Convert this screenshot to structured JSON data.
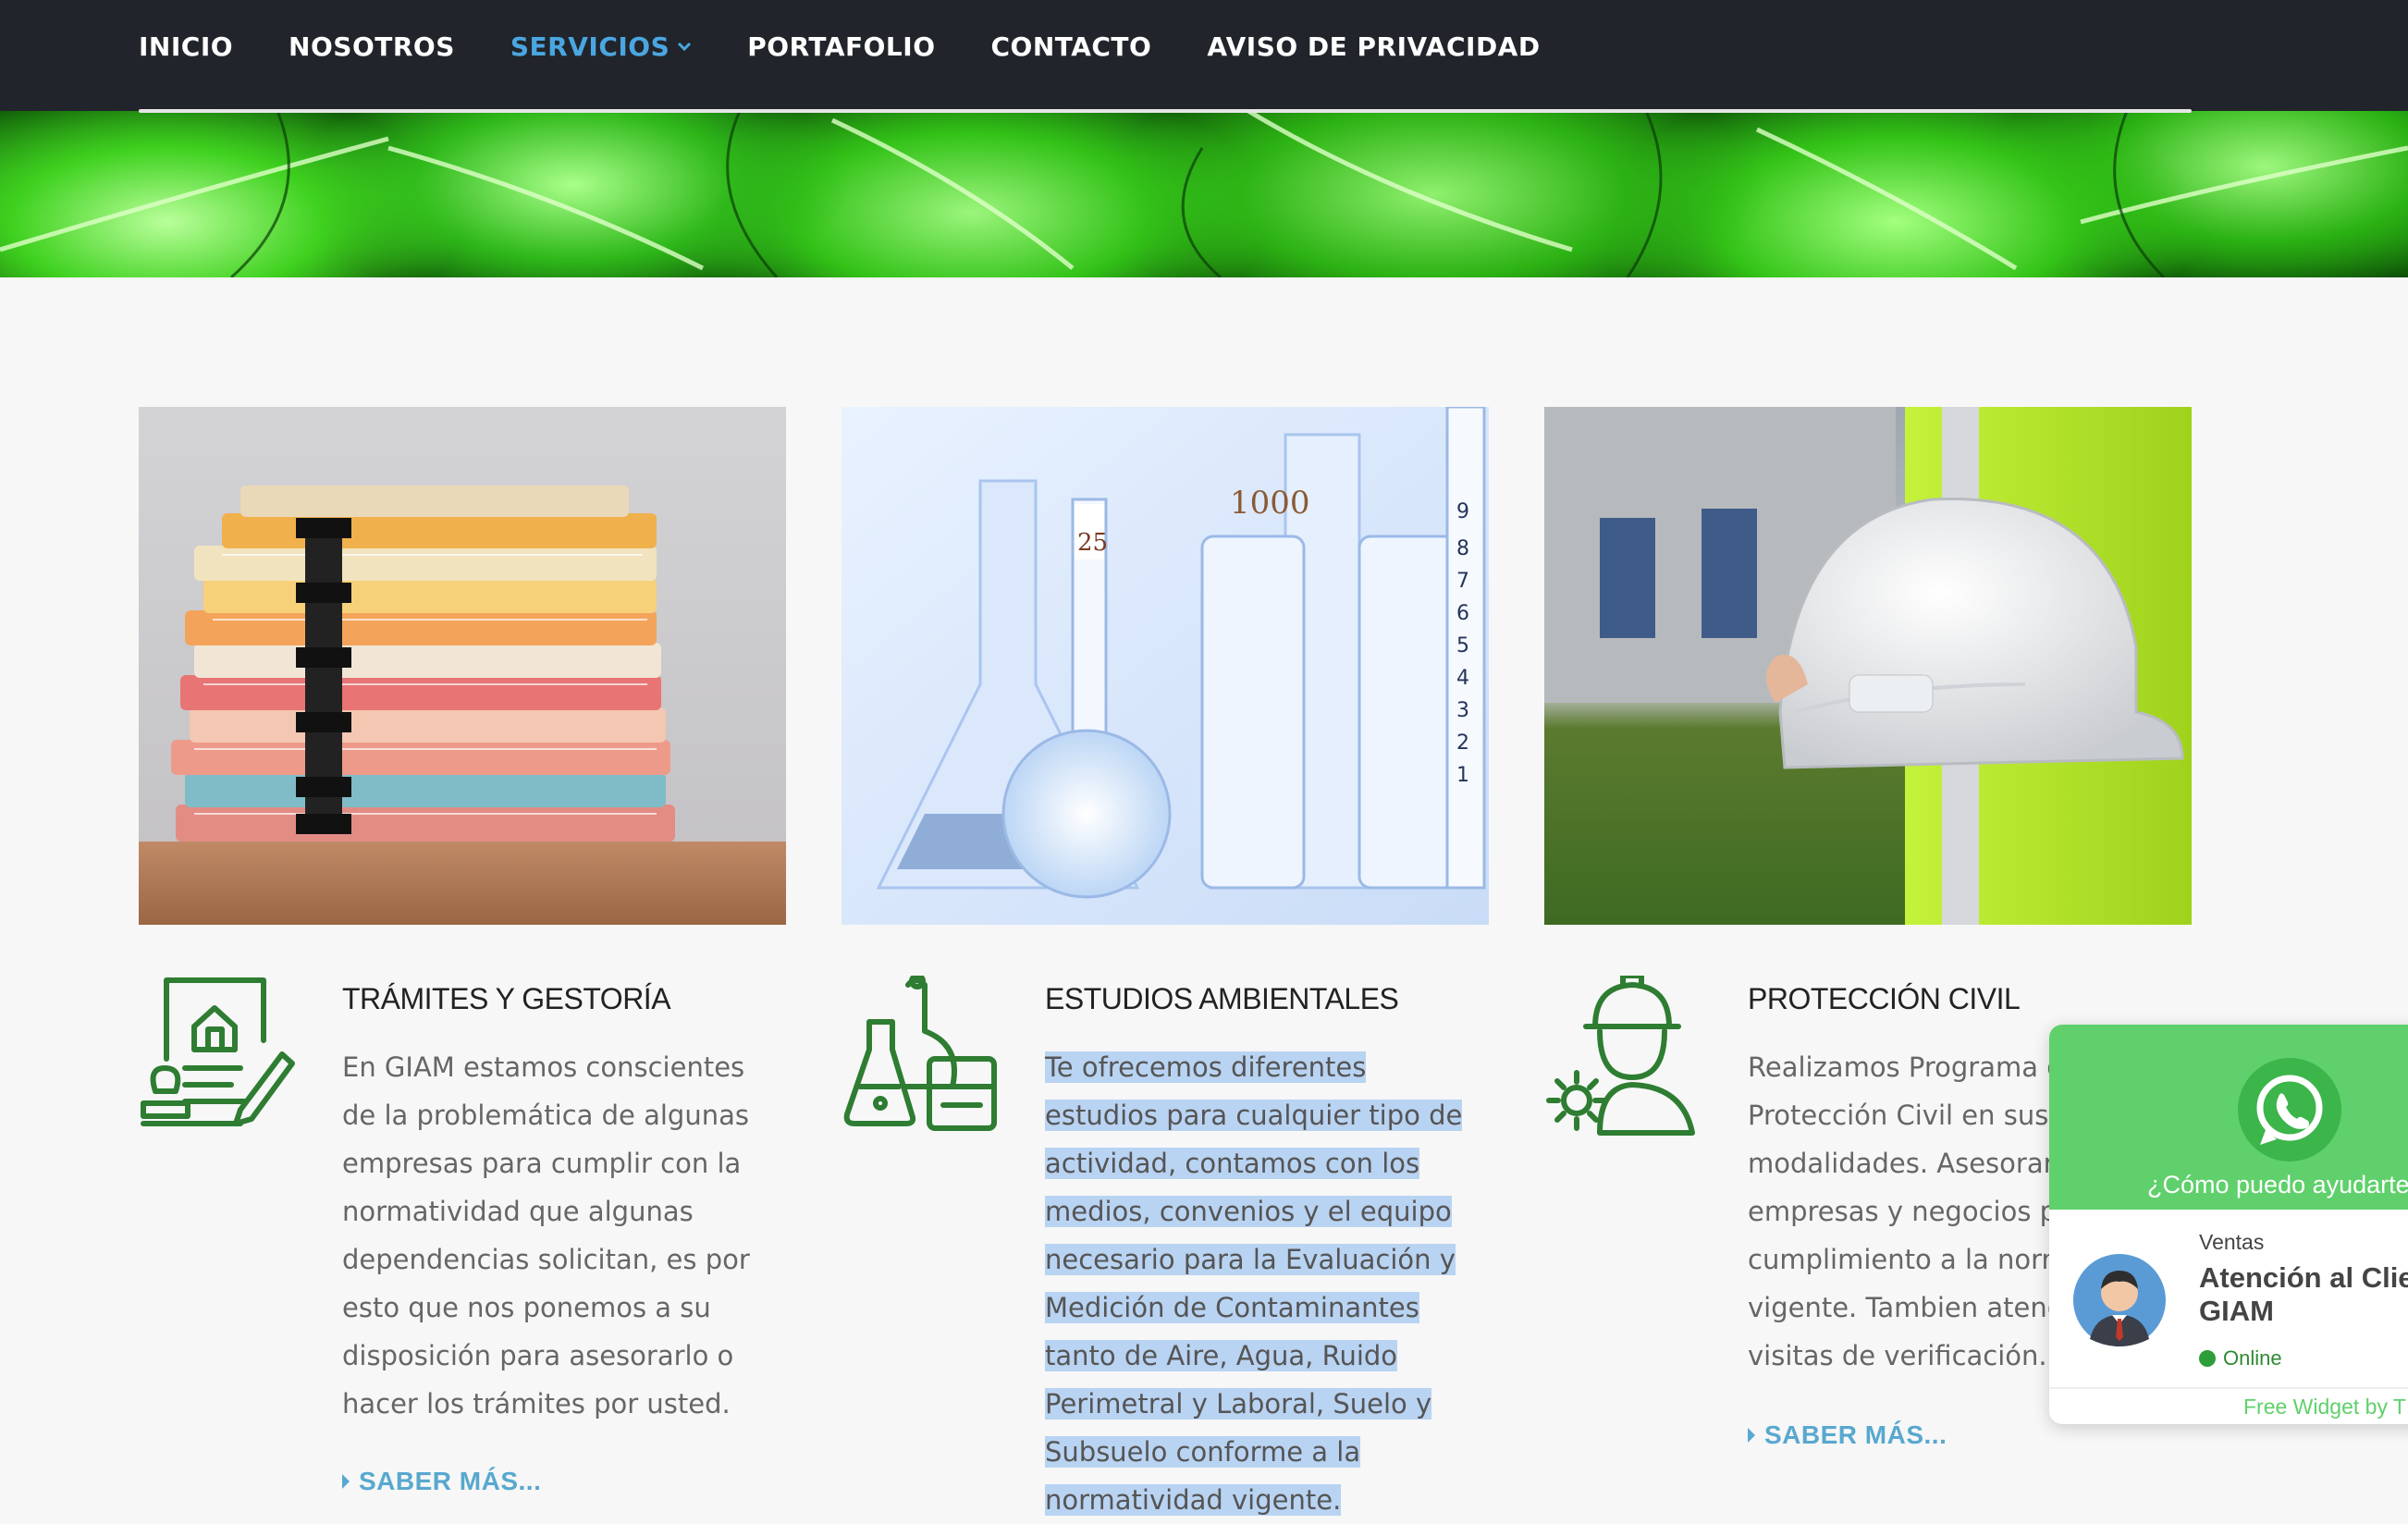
{
  "nav": {
    "items": [
      {
        "label": "INICIO"
      },
      {
        "label": "NOSOTROS"
      },
      {
        "label": "SERVICIOS"
      },
      {
        "label": "PORTAFOLIO"
      },
      {
        "label": "CONTACTO"
      },
      {
        "label": "AVISO DE PRIVACIDAD"
      }
    ],
    "active_color": "#4aa6e0"
  },
  "services": [
    {
      "title": "TRÁMITES Y GESTORÍA",
      "text": "En GIAM estamos conscientes de la problemática de algunas empresas para cumplir con la normatividad que algunas dependencias solicitan, es por esto que nos ponemos a su disposición para asesorarlo o hacer los trámites por usted.",
      "link": "SABER MÁS...",
      "icon": "document-stamp-icon",
      "image": "stacked-folders-image"
    },
    {
      "title": "ESTUDIOS AMBIENTALES",
      "text": "Te ofrecemos diferentes estudios para cualquier tipo de actividad, contamos con los medios, convenios y el equipo necesario para la Evaluación y Medición de Contaminantes tanto de Aire, Agua, Ruido Perimetral y Laboral, Suelo y Subsuelo conforme a la normatividad vigente.",
      "link": "",
      "icon": "lab-flasks-icon",
      "image": "lab-glassware-image"
    },
    {
      "title": "PROTECCIÓN CIVIL",
      "text": "Realizamos Programa d Protección Civil en sus d modalidades. Asesoram empresas y negocios pa cumplimiento a la norm vigente. Tambien atend visitas de verificación.",
      "link": "SABER MÁS...",
      "icon": "worker-gear-icon",
      "image": "hard-hat-image"
    }
  ],
  "whatsapp": {
    "help": "¿Cómo puedo ayudarte",
    "dept": "Ventas",
    "name_line1": "Atención al Clie",
    "name_line2": "GIAM",
    "status": "Online",
    "footer": "Free Widget by T",
    "color": "#5fd06b"
  },
  "colors": {
    "icon_green": "#2e7d32",
    "link_blue": "#58a8cf",
    "highlight": "#b9d3f2"
  }
}
